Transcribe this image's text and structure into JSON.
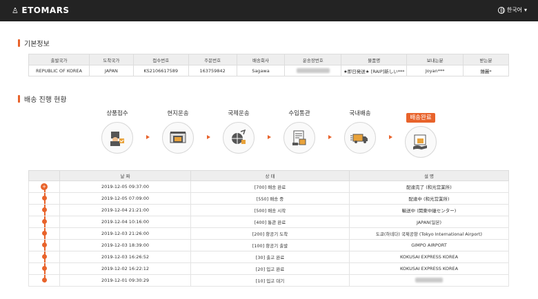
{
  "header": {
    "logo_text": "ETOMARS",
    "language": "한국어"
  },
  "basic_info": {
    "title": "기본정보",
    "columns": [
      "출발국가",
      "도착국가",
      "접수번호",
      "주문번호",
      "배송회사",
      "운송장번호",
      "물품명",
      "보내는분",
      "받는분"
    ],
    "row": {
      "origin": "REPUBLIC OF KOREA",
      "destination": "JAPAN",
      "receipt_no": "KS2106617589",
      "order_no": "163759842",
      "carrier": "Sagawa",
      "item": "★即日発送★ [RAIP]新しい***",
      "sender": "Joyan***",
      "receiver": "鍾麗*"
    }
  },
  "progress": {
    "title": "배송 진행 현황",
    "steps": [
      {
        "label": "상품접수",
        "icon": "package-receive-icon"
      },
      {
        "label": "현지운송",
        "icon": "local-truck-icon"
      },
      {
        "label": "국제운송",
        "icon": "globe-plane-icon"
      },
      {
        "label": "수입통관",
        "icon": "customs-document-icon"
      },
      {
        "label": "국내배송",
        "icon": "delivery-truck-icon"
      },
      {
        "label": "배송완료",
        "icon": "package-handover-icon",
        "active": true
      }
    ]
  },
  "history": {
    "columns": [
      "날 짜",
      "상 태",
      "설 명"
    ],
    "rows": [
      {
        "date": "2019-12-05 09:37:00",
        "status": "[700] 배송 완료",
        "desc": "配達完了 (和光営業所)"
      },
      {
        "date": "2019-12-05 07:09:00",
        "status": "[550] 배송 중",
        "desc": "配達中 (和光営業所)"
      },
      {
        "date": "2019-12-04 21:21:00",
        "status": "[500] 배송 시작",
        "desc": "輸送中 (関東中継センター)"
      },
      {
        "date": "2019-12-04 10:16:00",
        "status": "[400] 통관 완료",
        "desc": "JAPAN(일본)"
      },
      {
        "date": "2019-12-03 21:26:00",
        "status": "[200] 항공기 도착",
        "desc": "도쿄(하네다) 국제공항 (Tokyo International Airport)"
      },
      {
        "date": "2019-12-03 18:39:00",
        "status": "[100] 항공기 출발",
        "desc": "GIMPO AIRPORT"
      },
      {
        "date": "2019-12-03 16:26:52",
        "status": "[30] 출고 완료",
        "desc": "KOKUSAI EXPRESS KOREA"
      },
      {
        "date": "2019-12-02 16:22:12",
        "status": "[20] 입고 완료",
        "desc": "KOKUSAI EXPRESS KOREA"
      },
      {
        "date": "2019-12-01 09:30:29",
        "status": "[10] 입고 대기",
        "desc": ""
      }
    ]
  },
  "colors": {
    "accent": "#e8632b",
    "header_bg": "#232323"
  }
}
